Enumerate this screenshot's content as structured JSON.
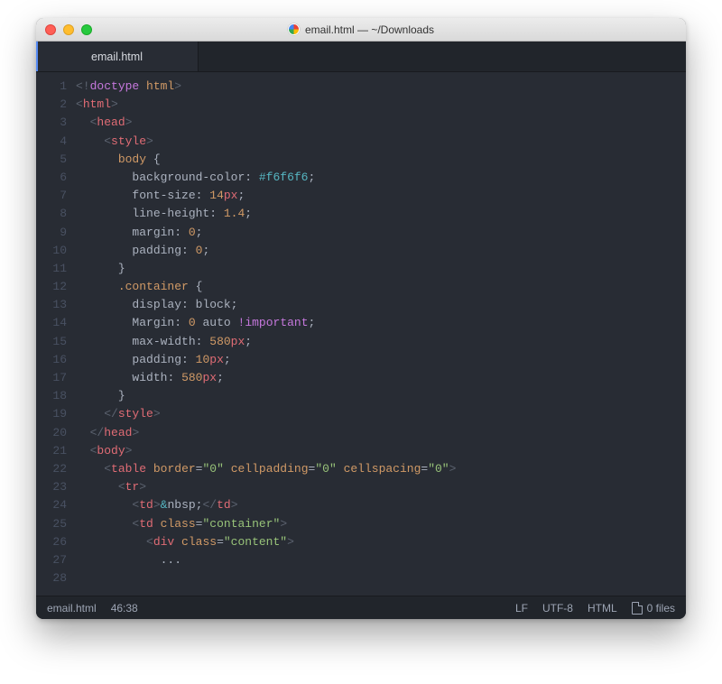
{
  "window": {
    "title": "email.html — ~/Downloads"
  },
  "tab": {
    "label": "email.html"
  },
  "lines": [
    {
      "n": 1,
      "html": "<span class='b'>&lt;!</span><span class='dt'>doctype</span> <span class='at'>html</span><span class='b'>&gt;</span>"
    },
    {
      "n": 2,
      "html": "<span class='b'>&lt;</span><span class='tg'>html</span><span class='b'>&gt;</span>"
    },
    {
      "n": 3,
      "html": "  <span class='b'>&lt;</span><span class='tg'>head</span><span class='b'>&gt;</span>"
    },
    {
      "n": 4,
      "html": "    <span class='b'>&lt;</span><span class='tg'>style</span><span class='b'>&gt;</span>"
    },
    {
      "n": 5,
      "html": "      <span class='sel'>body</span> <span class='p'>{</span>"
    },
    {
      "n": 6,
      "html": "        <span class='pr'>background-color</span><span class='p'>:</span> <span class='co'>#f6f6f6</span><span class='p'>;</span>"
    },
    {
      "n": 7,
      "html": "        <span class='pr'>font-size</span><span class='p'>:</span> <span class='at'>14</span><span class='tg'>px</span><span class='p'>;</span>"
    },
    {
      "n": 8,
      "html": "        <span class='pr'>line-height</span><span class='p'>:</span> <span class='at'>1.4</span><span class='p'>;</span>"
    },
    {
      "n": 9,
      "html": "        <span class='pr'>margin</span><span class='p'>:</span> <span class='at'>0</span><span class='p'>;</span>"
    },
    {
      "n": 10,
      "html": "        <span class='pr'>padding</span><span class='p'>:</span> <span class='at'>0</span><span class='p'>;</span>"
    },
    {
      "n": 11,
      "html": "      <span class='p'>}</span>"
    },
    {
      "n": 12,
      "html": "      <span class='sel'>.container</span> <span class='p'>{</span>"
    },
    {
      "n": 13,
      "html": "        <span class='pr'>display</span><span class='p'>:</span> <span class='pr'>block</span><span class='p'>;</span>"
    },
    {
      "n": 14,
      "html": "        <span class='pr'>Margin</span><span class='p'>:</span> <span class='at'>0</span> <span class='pr'>auto</span> <span class='kw'>!important</span><span class='p'>;</span>"
    },
    {
      "n": 15,
      "html": "        <span class='pr'>max-width</span><span class='p'>:</span> <span class='at'>580</span><span class='tg'>px</span><span class='p'>;</span>"
    },
    {
      "n": 16,
      "html": "        <span class='pr'>padding</span><span class='p'>:</span> <span class='at'>10</span><span class='tg'>px</span><span class='p'>;</span>"
    },
    {
      "n": 17,
      "html": "        <span class='pr'>width</span><span class='p'>:</span> <span class='at'>580</span><span class='tg'>px</span><span class='p'>;</span>"
    },
    {
      "n": 18,
      "html": "      <span class='p'>}</span>"
    },
    {
      "n": 19,
      "html": "    <span class='b'>&lt;/</span><span class='tg'>style</span><span class='b'>&gt;</span>"
    },
    {
      "n": 20,
      "html": "  <span class='b'>&lt;/</span><span class='tg'>head</span><span class='b'>&gt;</span>"
    },
    {
      "n": 21,
      "html": "  <span class='b'>&lt;</span><span class='tg'>body</span><span class='b'>&gt;</span>"
    },
    {
      "n": 22,
      "html": "    <span class='b'>&lt;</span><span class='tg'>table</span> <span class='at'>border</span><span class='p'>=</span><span class='st'>\"0\"</span> <span class='at'>cellpadding</span><span class='p'>=</span><span class='st'>\"0\"</span> <span class='at'>cellspacing</span><span class='p'>=</span><span class='st'>\"0\"</span><span class='b'>&gt;</span>"
    },
    {
      "n": 23,
      "html": "      <span class='b'>&lt;</span><span class='tg'>tr</span><span class='b'>&gt;</span>"
    },
    {
      "n": 24,
      "html": "        <span class='b'>&lt;</span><span class='tg'>td</span><span class='b'>&gt;</span><span class='op'>&amp;</span><span class='pr'>nbsp;</span><span class='b'>&lt;/</span><span class='tg'>td</span><span class='b'>&gt;</span>"
    },
    {
      "n": 25,
      "html": "        <span class='b'>&lt;</span><span class='tg'>td</span> <span class='at'>class</span><span class='p'>=</span><span class='st'>\"container\"</span><span class='b'>&gt;</span>"
    },
    {
      "n": 26,
      "html": "          <span class='b'>&lt;</span><span class='tg'>div</span> <span class='at'>class</span><span class='p'>=</span><span class='st'>\"content\"</span><span class='b'>&gt;</span>"
    },
    {
      "n": 27,
      "html": "            <span class='p'>...</span>"
    },
    {
      "n": 28,
      "html": ""
    }
  ],
  "status": {
    "filename": "email.html",
    "cursor": "46:38",
    "lineEnding": "LF",
    "encoding": "UTF-8",
    "grammar": "HTML",
    "files": "0 files"
  }
}
